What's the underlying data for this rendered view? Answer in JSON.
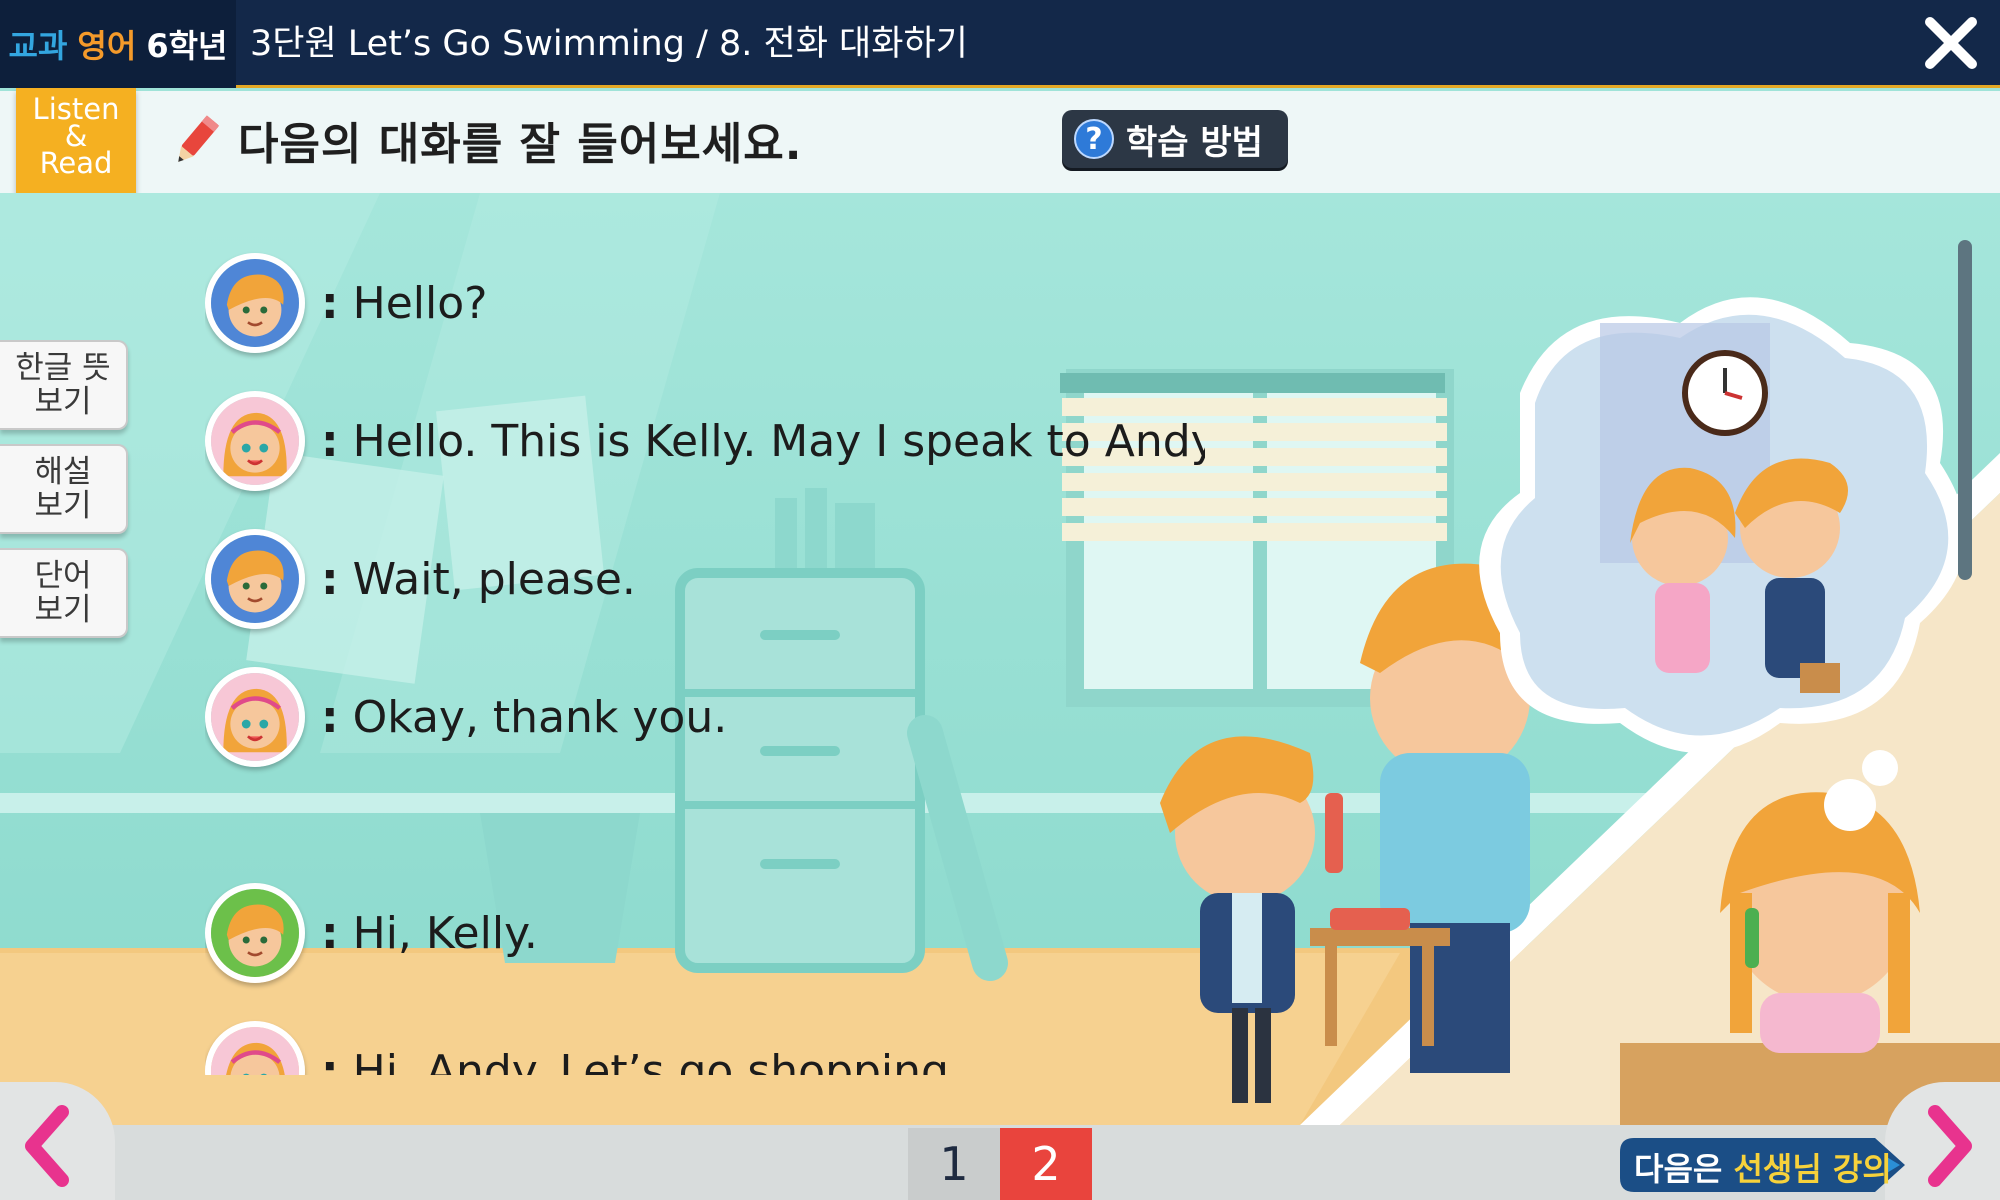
{
  "header": {
    "subject_part1": "교과",
    "subject_part2": "영어",
    "subject_part3": "6학년",
    "lesson_title": "3단원 Let’s Go Swimming / 8. 전화 대화하기",
    "close_icon": "close-icon"
  },
  "instruction": {
    "text": "다음의 대화를 잘 들어보세요.",
    "help_label": "학습 방법"
  },
  "listen_read": {
    "line1": "Listen",
    "line2": "&",
    "line3": "Read"
  },
  "side_buttons": [
    {
      "label": "한글 뜻\n보기"
    },
    {
      "label": "해설\n보기"
    },
    {
      "label": "단어\n보기"
    }
  ],
  "dialogue": [
    {
      "speaker": "boy-andy",
      "text": "Hello?"
    },
    {
      "speaker": "girl-kelly",
      "text": "Hello. This is Kelly. May I speak to Andy?"
    },
    {
      "speaker": "boy-andy",
      "text": "Wait, please."
    },
    {
      "speaker": "girl-kelly",
      "text": "Okay, thank you."
    },
    {
      "speaker": "boy-green",
      "text": "Hi, Kelly."
    },
    {
      "speaker": "girl-kelly",
      "text": "Hi, Andy. Let’s go shopping."
    }
  ],
  "colon": ":",
  "pagination": {
    "pages": [
      "1",
      "2"
    ],
    "current": "2"
  },
  "footer": {
    "next_part1": "다음은 ",
    "next_part2": "선생님 강의"
  },
  "colors": {
    "topbar": "#132849",
    "accent_orange": "#f5b021",
    "page_active": "#e9443d",
    "nav_arrow": "#e8338e"
  }
}
